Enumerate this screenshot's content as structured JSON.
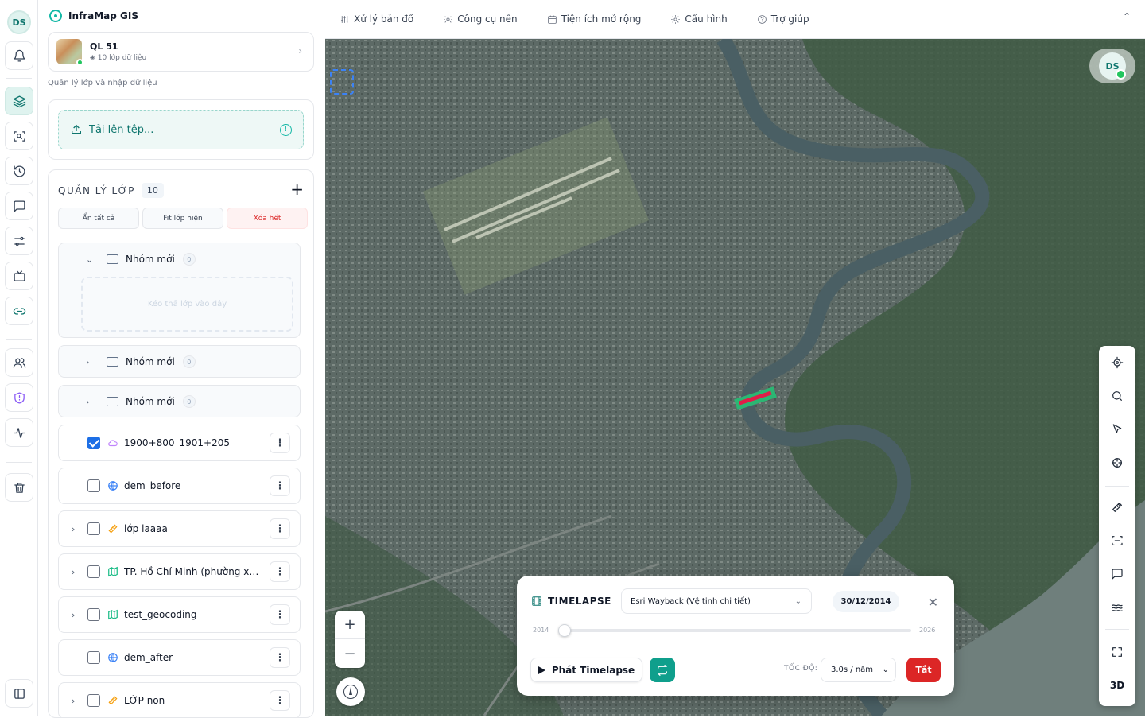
{
  "rail": {
    "avatar": "DS"
  },
  "brand": {
    "name": "InfraMap GIS"
  },
  "project": {
    "name": "QL 51",
    "subtitle": "10 lớp dữ liệu"
  },
  "hint": "Quản lý lớp và nhập dữ liệu",
  "upload": {
    "label": "Tải lên tệp..."
  },
  "layers": {
    "heading": "QUẢN LÝ LỚP",
    "count": "10",
    "actions": {
      "hide_all": "Ẩn tất cả",
      "fit_visible": "Fit lớp hiện",
      "clear_all": "Xóa hết"
    },
    "groups": [
      {
        "name": "Nhóm mới",
        "count": "0",
        "expanded": true,
        "drop_hint": "Kéo thả lớp vào đây"
      },
      {
        "name": "Nhóm mới",
        "count": "0",
        "expanded": false
      },
      {
        "name": "Nhóm mới",
        "count": "0",
        "expanded": false
      }
    ],
    "items": [
      {
        "name": "1900+800_1901+205",
        "checked": true,
        "icon": "cloud-icon",
        "expandable": false
      },
      {
        "name": "dem_before",
        "checked": false,
        "icon": "globe-icon",
        "expandable": false
      },
      {
        "name": "lớp laaaa",
        "checked": false,
        "icon": "ruler-icon",
        "expandable": true
      },
      {
        "name": "TP. Hồ Chí Minh (phường xã) -...",
        "checked": false,
        "icon": "map-icon",
        "expandable": true
      },
      {
        "name": "test_geocoding",
        "checked": false,
        "icon": "map-icon",
        "expandable": true
      },
      {
        "name": "dem_after",
        "checked": false,
        "icon": "globe-icon",
        "expandable": false
      },
      {
        "name": "LỚP non",
        "checked": false,
        "icon": "ruler-icon",
        "expandable": true
      }
    ]
  },
  "topbar": {
    "menu": [
      "Xử lý bản đồ",
      "Công cụ nền",
      "Tiện ích mở rộng",
      "Cấu hình",
      "Trợ giúp"
    ]
  },
  "map": {
    "avatar": "DS",
    "tool_3d": "3D"
  },
  "timelapse": {
    "title": "TIMELAPSE",
    "source": "Esri Wayback (Vệ tinh chi tiết)",
    "date": "30/12/2014",
    "year_start": "2014",
    "year_end": "2026",
    "progress": 0.0,
    "play_label": "Phát Timelapse",
    "speed_label": "TỐC ĐỘ:",
    "speed": "3.0s / năm",
    "off_label": "Tắt"
  }
}
